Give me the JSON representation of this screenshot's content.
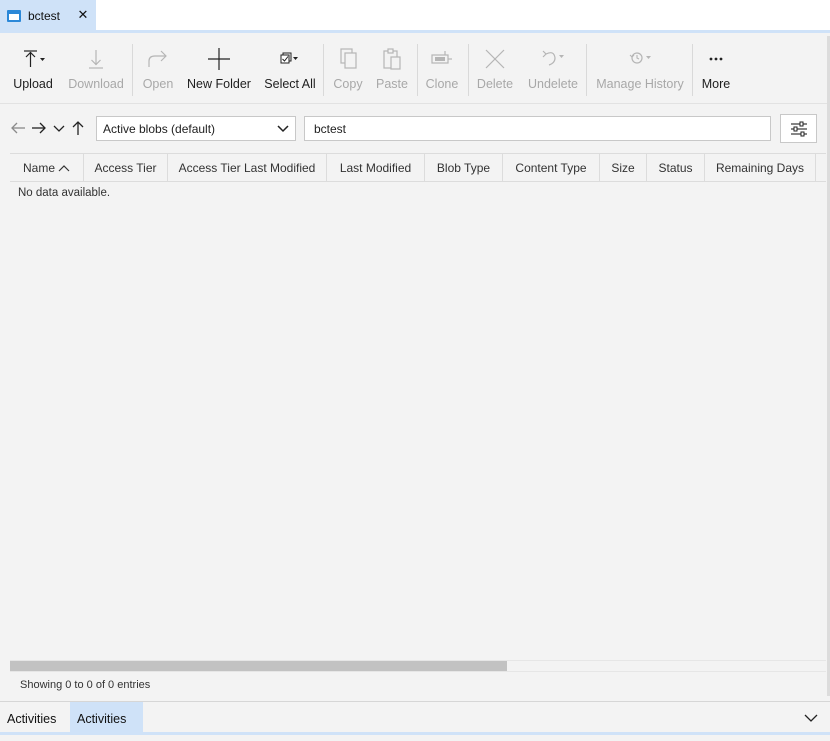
{
  "tab": {
    "title": "bctest",
    "close_glyph": "✕"
  },
  "toolbar": {
    "buttons": [
      {
        "label": "Upload",
        "icon": "upload-icon",
        "enabled": true
      },
      {
        "label": "Download",
        "icon": "download-icon",
        "enabled": false
      },
      {
        "label": "Open",
        "icon": "open-icon",
        "enabled": false
      },
      {
        "label": "New Folder",
        "icon": "plus-icon",
        "enabled": true
      },
      {
        "label": "Select All",
        "icon": "select-all-icon",
        "enabled": true
      },
      {
        "label": "Copy",
        "icon": "copy-icon",
        "enabled": false
      },
      {
        "label": "Paste",
        "icon": "paste-icon",
        "enabled": false
      },
      {
        "label": "Clone",
        "icon": "clone-icon",
        "enabled": false
      },
      {
        "label": "Delete",
        "icon": "delete-icon",
        "enabled": false
      },
      {
        "label": "Undelete",
        "icon": "undelete-icon",
        "enabled": false
      },
      {
        "label": "Manage History",
        "icon": "history-icon",
        "enabled": false
      },
      {
        "label": "More",
        "icon": "more-icon",
        "enabled": true
      }
    ]
  },
  "nav": {
    "view_dropdown": {
      "value": "Active blobs (default)"
    },
    "path": "bctest"
  },
  "grid": {
    "columns": [
      {
        "label": "Name",
        "sorted": "ascending"
      },
      {
        "label": "Access Tier"
      },
      {
        "label": "Access Tier Last Modified"
      },
      {
        "label": "Last Modified"
      },
      {
        "label": "Blob Type"
      },
      {
        "label": "Content Type"
      },
      {
        "label": "Size"
      },
      {
        "label": "Status"
      },
      {
        "label": "Remaining Days"
      }
    ],
    "empty_text": "No data available.",
    "footer": "Showing 0 to 0 of 0 entries"
  },
  "activities": {
    "tabs": [
      {
        "label": "Activities"
      },
      {
        "label": "Activities",
        "active": true
      }
    ]
  },
  "colors": {
    "accent": "#cfe2f8",
    "icon_blue": "#2b88d8",
    "disabled": "#a8a8a8"
  }
}
